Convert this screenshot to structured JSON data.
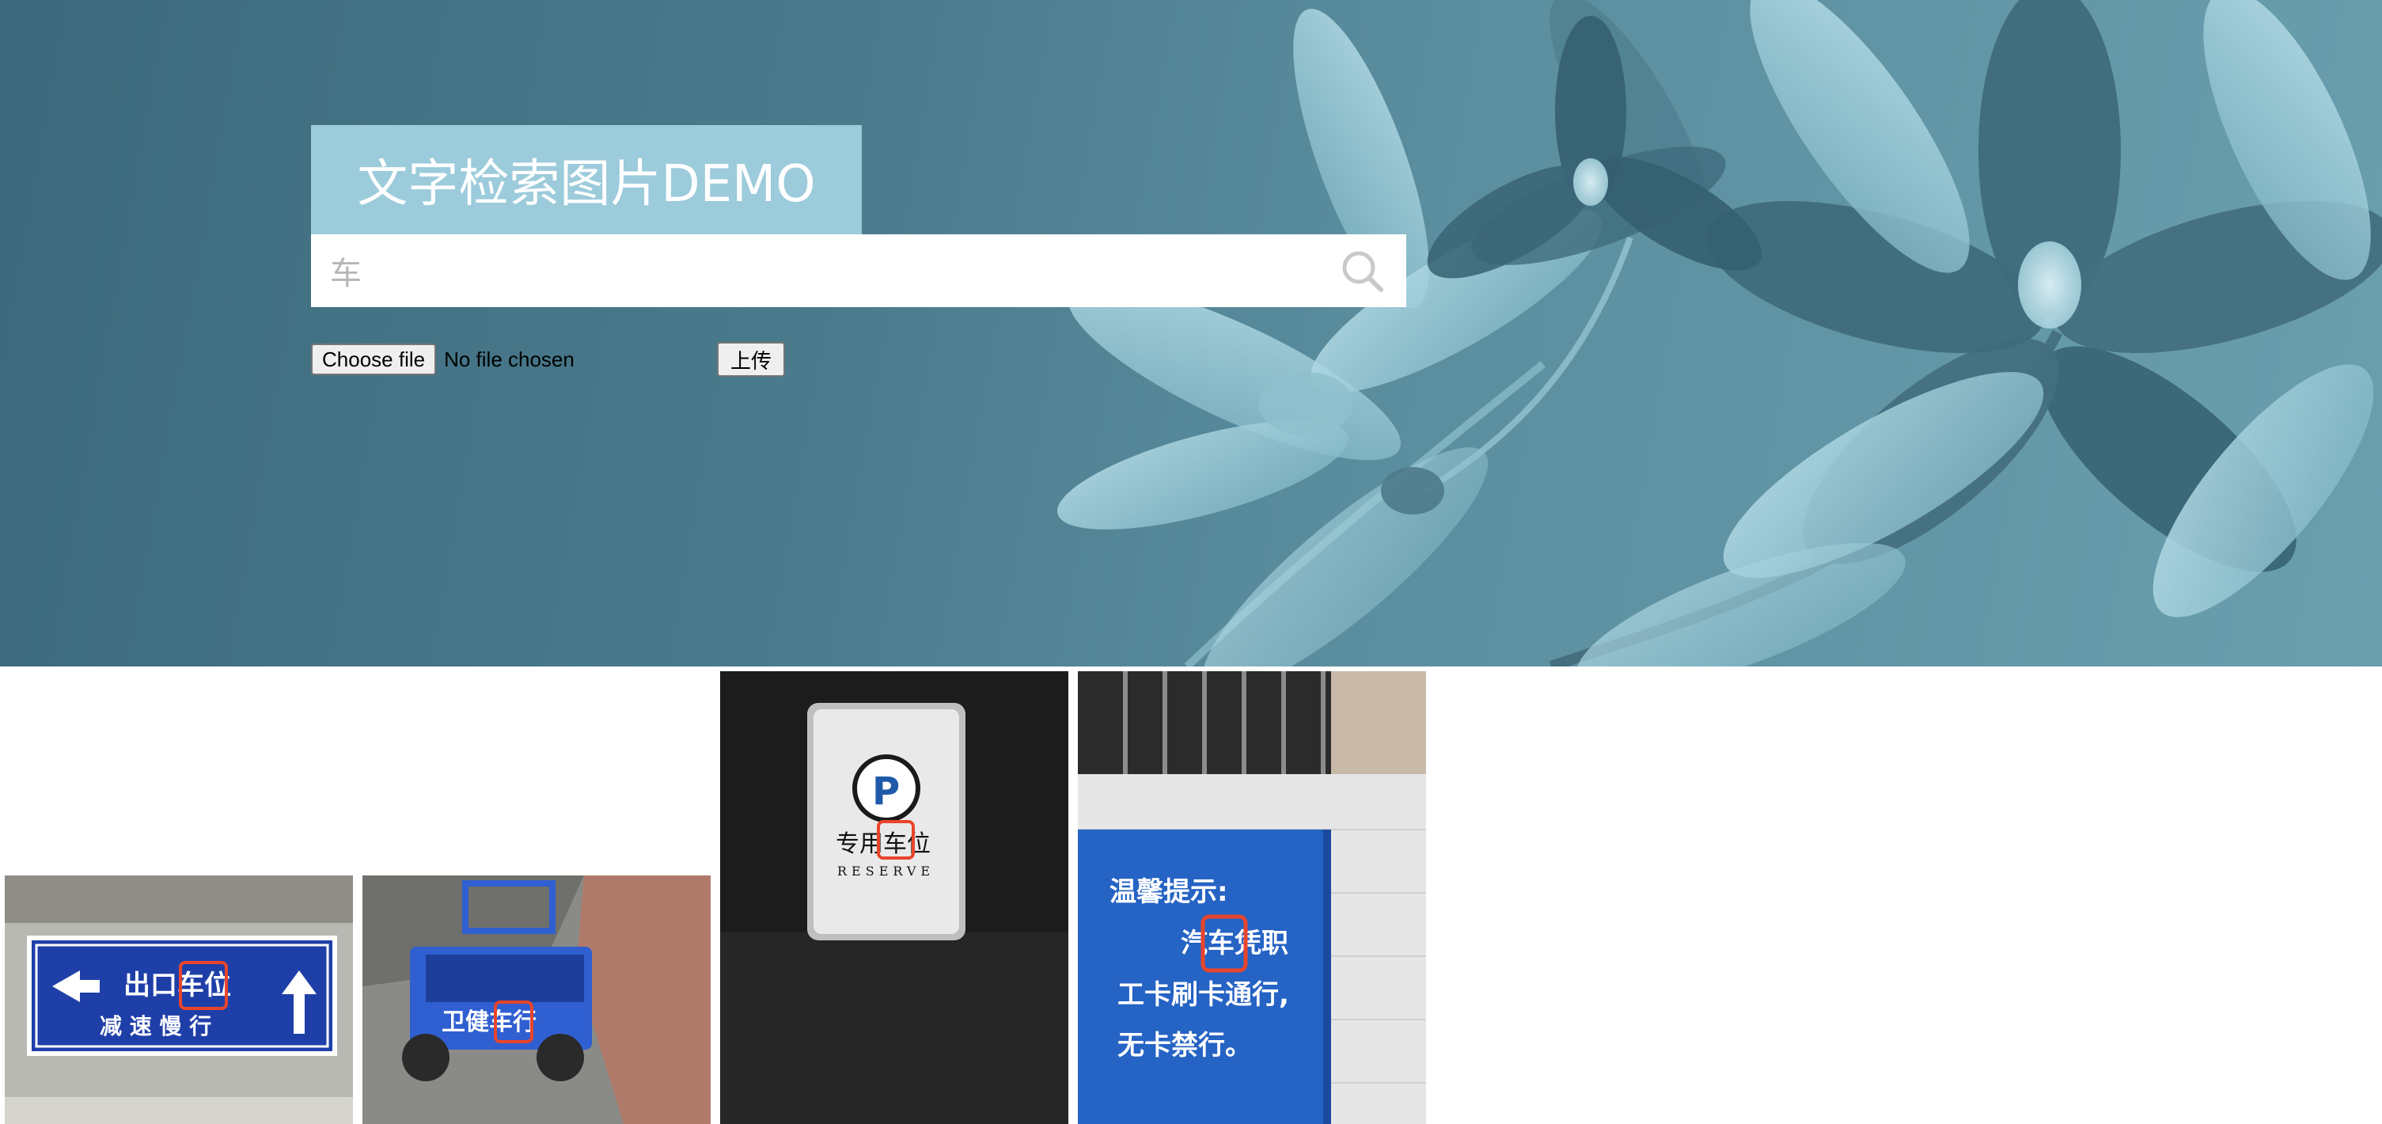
{
  "header": {
    "title": "文字检索图片DEMO"
  },
  "search": {
    "value": "车",
    "icon": "search-icon"
  },
  "upload": {
    "choose_label": "Choose file",
    "file_status": "No file chosen",
    "submit_label": "上传"
  },
  "colors": {
    "title_bg": "#9ccbdb",
    "hero_bg": "#4a7b8d",
    "highlight_box": "#e8452c",
    "sign_blue": "#1f3fa8"
  },
  "results": [
    {
      "lines": [
        "出口车位",
        "减 速 慢 行"
      ],
      "highlight": "车"
    },
    {
      "lines": [
        "卫健车行"
      ],
      "highlight": "车"
    },
    {
      "lines": [
        "专用车位",
        "RESERVE"
      ],
      "highlight": "车"
    },
    {
      "lines": [
        "温馨提示:",
        "汽车凭职",
        "工卡刷卡通行,",
        "无卡禁行。"
      ],
      "highlight": "车"
    }
  ]
}
